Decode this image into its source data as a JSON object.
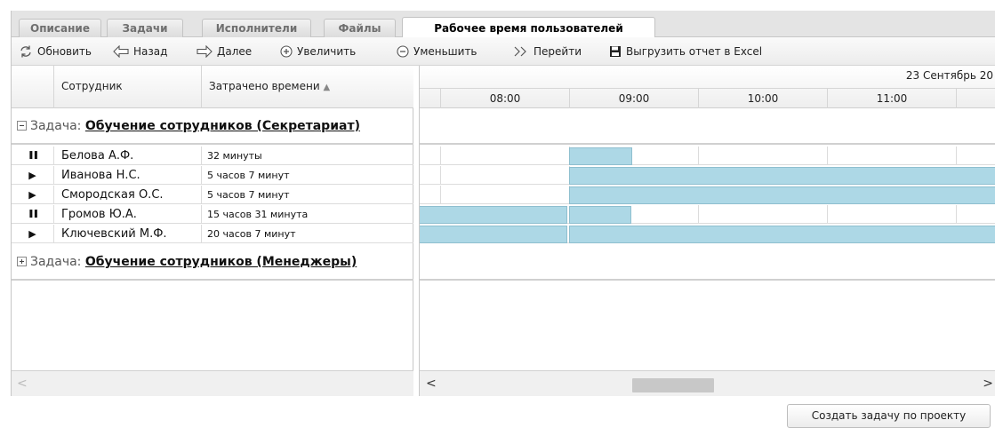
{
  "tabs": [
    {
      "label": "Описание"
    },
    {
      "label": "Задачи"
    },
    {
      "label": "Исполнители"
    },
    {
      "label": "Файлы"
    },
    {
      "label": "Рабочее время пользователей"
    }
  ],
  "toolbar": {
    "refresh": "Обновить",
    "back": "Назад",
    "forward": "Далее",
    "zoom_in": "Увеличить",
    "zoom_out": "Уменьшить",
    "goto": "Перейти",
    "export": "Выгрузить отчет в Excel"
  },
  "grid": {
    "col_employee": "Сотрудник",
    "col_time": "Затрачено времени",
    "sort_indicator": "▲"
  },
  "groups": [
    {
      "prefix": "Задача: ",
      "name": "Обучение сотрудников (Секретариат)",
      "expanded": true
    },
    {
      "prefix": "Задача: ",
      "name": "Обучение сотрудников (Менеджеры)",
      "expanded": false
    }
  ],
  "rows": [
    {
      "icon": "pause-icon",
      "glyph": "❚❚",
      "name": "Белова А.Ф.",
      "time": "32 минуты"
    },
    {
      "icon": "play-icon",
      "glyph": "▶",
      "name": "Иванова Н.С.",
      "time": "5 часов 7 минут"
    },
    {
      "icon": "play-icon",
      "glyph": "▶",
      "name": "Смородская О.С.",
      "time": "5 часов 7 минут"
    },
    {
      "icon": "pause-icon",
      "glyph": "❚❚",
      "name": "Громов Ю.А.",
      "time": "15 часов 31 минута"
    },
    {
      "icon": "play-icon",
      "glyph": "▶",
      "name": "Ключевский М.Ф.",
      "time": "20 часов 7 минут"
    }
  ],
  "timeline": {
    "date": "23 Сентябрь 20",
    "hours": [
      "08:00",
      "09:00",
      "10:00",
      "11:00"
    ],
    "bar_color": "#add8e6"
  },
  "scroll": {
    "left": "<",
    "right": ">"
  },
  "footer": {
    "create_task": "Создать задачу по проекту"
  }
}
